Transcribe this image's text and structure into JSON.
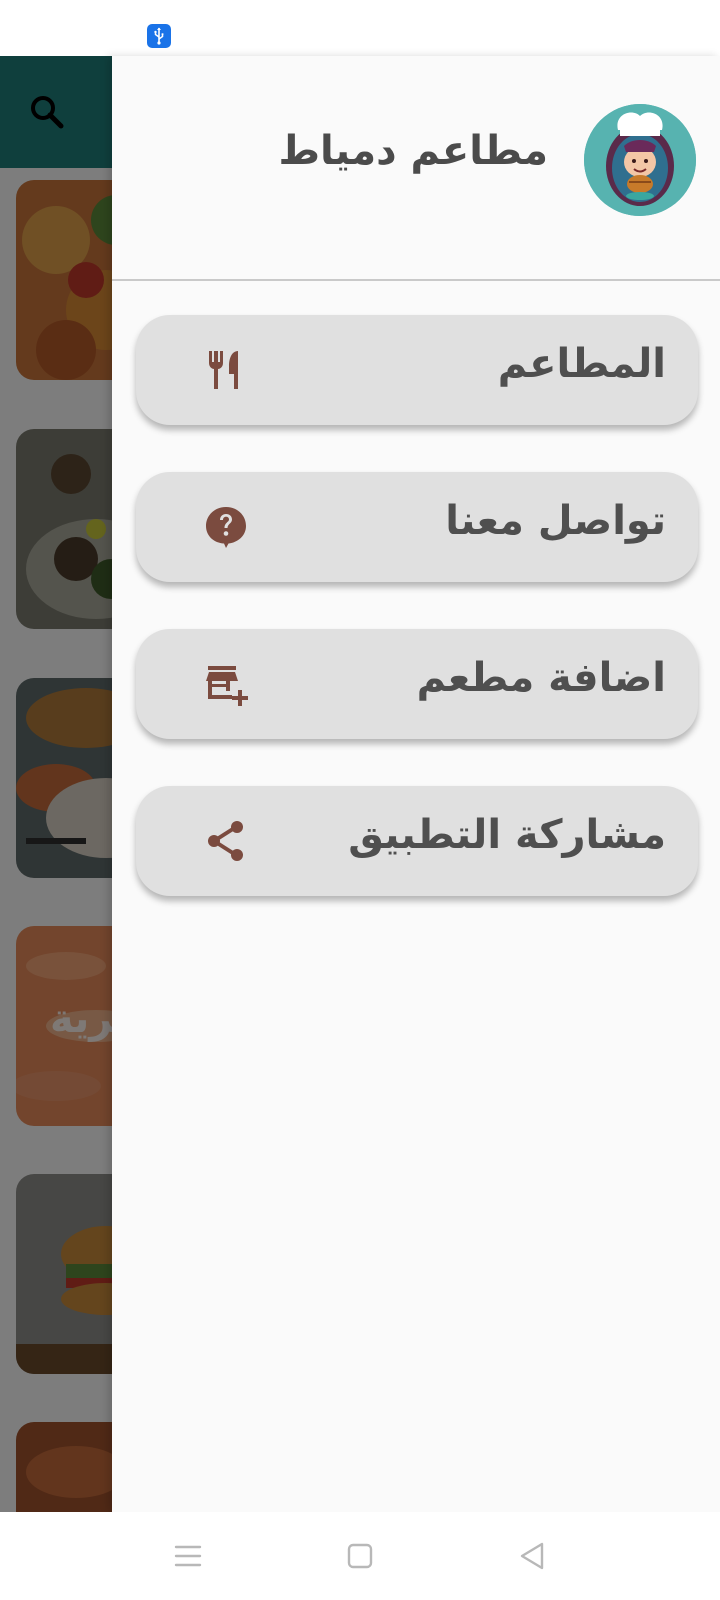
{
  "drawer": {
    "app_title": "مطاعم دمياط",
    "logo_icon": "chef-logo-icon",
    "items": [
      {
        "label": "المطاعم",
        "icon": "fork-knife-icon"
      },
      {
        "label": "تواصل معنا",
        "icon": "help-bubble-icon"
      },
      {
        "label": "اضافة مطعم",
        "icon": "add-store-icon"
      },
      {
        "label": "مشاركة التطبيق",
        "icon": "share-icon"
      }
    ]
  },
  "background": {
    "search_icon": "search-icon",
    "cards": [
      {
        "title": ""
      },
      {
        "title": ""
      },
      {
        "title": ""
      },
      {
        "title": "بحرية"
      },
      {
        "title": ""
      },
      {
        "title": ""
      }
    ]
  },
  "status_bar": {
    "icon": "usb-icon"
  },
  "nav_bar": {
    "icons": [
      "menu-icon",
      "home-icon",
      "back-icon"
    ]
  },
  "colors": {
    "appbar_teal": "#1f7f7a",
    "menu_icon_brown": "#7b4b3f",
    "menu_bg": "#e0e0e0",
    "drawer_bg": "#fafafa",
    "logo_bg": "#57b3b0"
  }
}
